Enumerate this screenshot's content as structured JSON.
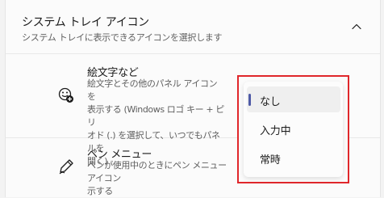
{
  "section": {
    "title": "システム トレイ アイコン",
    "subtitle": "システム トレイに表示できるアイコンを選択します",
    "icon": "chevron-up-icon"
  },
  "rows": [
    {
      "title": "絵文字など",
      "description_lines": [
        "絵文字とその他のパネル アイコンを",
        "表示する (Windows ロゴ キー + ピリ",
        "オド (.) を選択して、いつでもパネルを",
        "開く)"
      ],
      "icon": "emoji-add-icon"
    },
    {
      "title": "ペン メニュー",
      "description_lines": [
        "ペンが使用中のときにペン メニュー アイコン",
        "示する"
      ],
      "icon": "pen-icon"
    }
  ],
  "dropdown": {
    "options": [
      "なし",
      "入力中",
      "常時"
    ],
    "selected": "なし",
    "accent_color": "#4e5aa6",
    "highlight_color": "#e0272b"
  }
}
